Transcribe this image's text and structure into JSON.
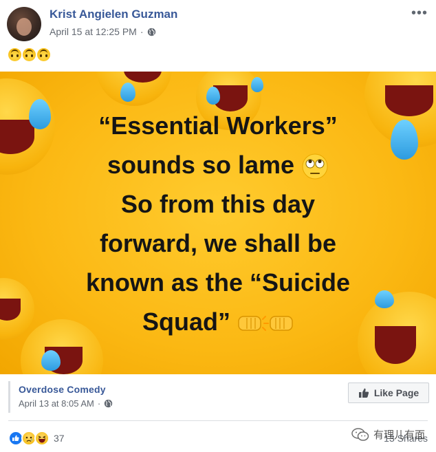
{
  "post": {
    "author": "Krist Angielen Guzman",
    "timestamp": "April 15 at 12:25 PM",
    "audience_icon": "globe-icon",
    "more_icon": "more-options-icon",
    "more_label": "•••",
    "text_emojis": [
      "upside-down-face",
      "upside-down-face",
      "upside-down-face"
    ]
  },
  "shared_image": {
    "lines": [
      "“Essential Workers”",
      "sounds so lame",
      "So from this day",
      "forward, we shall be",
      "known as the “Suicide",
      "Squad”"
    ],
    "inline_emojis": [
      "face-with-rolling-eyes",
      "fist-bump"
    ],
    "background_color": "#fbb813"
  },
  "source_page": {
    "name": "Overdose Comedy",
    "timestamp": "April 13 at 8:05 AM",
    "audience_icon": "globe-icon",
    "like_page_label": "Like Page",
    "like_icon": "thumbs-up-icon"
  },
  "footer": {
    "reactions": [
      "like",
      "sad",
      "haha"
    ],
    "reaction_count": "37",
    "shares": "13 Shares",
    "watermark": "有理儿有面"
  },
  "colors": {
    "link_blue": "#385898",
    "meta_gray": "#616770",
    "facebook_blue": "#1877f2"
  }
}
